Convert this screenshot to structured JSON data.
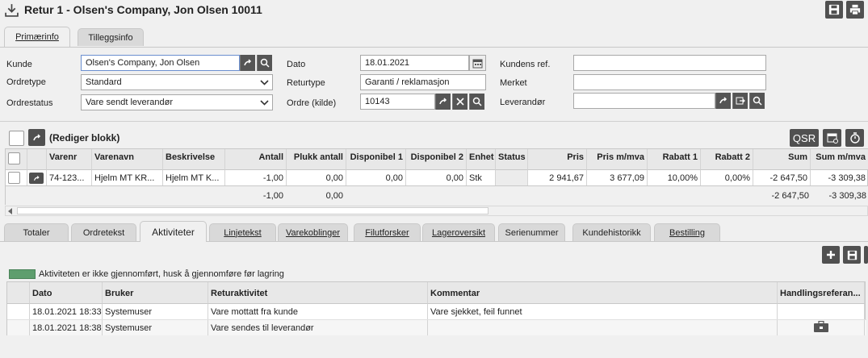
{
  "title": "Retur 1 - Olsen's Company, Jon Olsen 10011",
  "tabs": [
    "Primærinfo",
    "Tilleggsinfo"
  ],
  "form": {
    "kunde_label": "Kunde",
    "kunde_value": "Olsen's Company, Jon Olsen",
    "ordretype_label": "Ordretype",
    "ordretype_value": "Standard",
    "ordrestatus_label": "Ordrestatus",
    "ordrestatus_value": "Vare sendt leverandør",
    "dato_label": "Dato",
    "dato_value": "18.01.2021",
    "returtype_label": "Returtype",
    "returtype_value": "Garanti / reklamasjon",
    "ordre_label": "Ordre (kilde)",
    "ordre_value": "10143",
    "kundens_ref_label": "Kundens ref.",
    "kundens_ref_value": "",
    "merket_label": "Merket",
    "merket_value": "",
    "leverandor_label": "Leverandør",
    "leverandor_value": ""
  },
  "block": {
    "label": "(Rediger blokk)",
    "qsr": "QSR"
  },
  "grid": {
    "headers": [
      "Varenr",
      "Varenavn",
      "Beskrivelse",
      "Antall",
      "Plukk antall",
      "Disponibel 1",
      "Disponibel 2",
      "Enhet",
      "Status",
      "Pris",
      "Pris m/mva",
      "Rabatt 1",
      "Rabatt 2",
      "Sum",
      "Sum m/mva"
    ],
    "rows": [
      [
        "74-123...",
        "Hjelm MT KR...",
        "Hjelm MT K...",
        "-1,00",
        "0,00",
        "0,00",
        "0,00",
        "Stk",
        "",
        "2 941,67",
        "3 677,09",
        "10,00%",
        "0,00%",
        "-2 647,50",
        "-3 309,38"
      ]
    ],
    "totals": {
      "antall": "-1,00",
      "plukk": "0,00",
      "sum": "-2 647,50",
      "sum_mva": "-3 309,38"
    }
  },
  "bottom_tabs": [
    "Totaler",
    "Ordretekst",
    "Aktiviteter",
    "Linjetekst",
    "Varekoblinger",
    "Filutforsker",
    "Lageroversikt",
    "Serienummer",
    "Kundehistorikk",
    "Bestilling"
  ],
  "legend_text": "Aktiviteten er ikke gjennomført, husk å gjennomføre før lagring",
  "activities": {
    "headers": [
      "Dato",
      "Bruker",
      "Returaktivitet",
      "Kommentar",
      "Handlingsreferan..."
    ],
    "rows": [
      [
        "18.01.2021 18:33",
        "Systemuser",
        "Vare mottatt fra kunde",
        "Vare sjekket, feil funnet",
        ""
      ],
      [
        "18.01.2021 18:38",
        "Systemuser",
        "Vare sendes til leverandør",
        "",
        "briefcase-icon"
      ]
    ]
  },
  "colors": {
    "accent_dark": "#505050",
    "legend_green": "#5e9e6e"
  }
}
